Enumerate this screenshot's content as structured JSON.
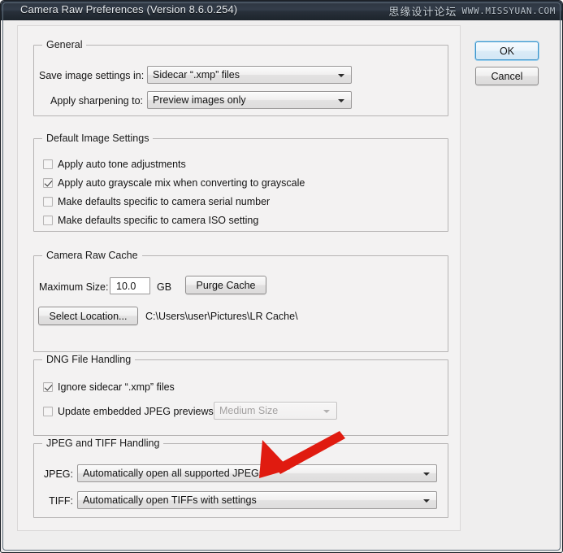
{
  "window": {
    "title": "Camera Raw Preferences  (Version 8.6.0.254)",
    "watermark_cn": "思缘设计论坛",
    "watermark_url": "WWW.MISSYUAN.COM"
  },
  "buttons": {
    "ok": "OK",
    "cancel": "Cancel"
  },
  "general": {
    "title": "General",
    "save_label": "Save image settings in:",
    "save_value": "Sidecar “.xmp” files",
    "sharpen_label": "Apply sharpening to:",
    "sharpen_value": "Preview images only"
  },
  "default_image_settings": {
    "title": "Default Image Settings",
    "checkboxes": [
      {
        "label": "Apply auto tone adjustments",
        "checked": false
      },
      {
        "label": "Apply auto grayscale mix when converting to grayscale",
        "checked": true
      },
      {
        "label": "Make defaults specific to camera serial number",
        "checked": false
      },
      {
        "label": "Make defaults specific to camera ISO setting",
        "checked": false
      }
    ]
  },
  "camera_raw_cache": {
    "title": "Camera Raw Cache",
    "max_size_label": "Maximum Size:",
    "max_size_value": "10.0",
    "units": "GB",
    "purge_button": "Purge Cache",
    "select_location_button": "Select Location...",
    "cache_path": "C:\\Users\\user\\Pictures\\LR Cache\\"
  },
  "dng_file_handling": {
    "title": "DNG File Handling",
    "checkboxes": [
      {
        "label": "Ignore sidecar “.xmp” files",
        "checked": true
      },
      {
        "label": "Update embedded JPEG previews:",
        "checked": false
      }
    ],
    "preview_size_value": "Medium Size"
  },
  "jpeg_tiff_handling": {
    "title": "JPEG and TIFF Handling",
    "jpeg_label": "JPEG:",
    "jpeg_value": "Automatically open all supported JPEGs",
    "tiff_label": "TIFF:",
    "tiff_value": "Automatically open TIFFs with settings"
  },
  "annotation": {
    "arrow_color": "#e01b10"
  }
}
